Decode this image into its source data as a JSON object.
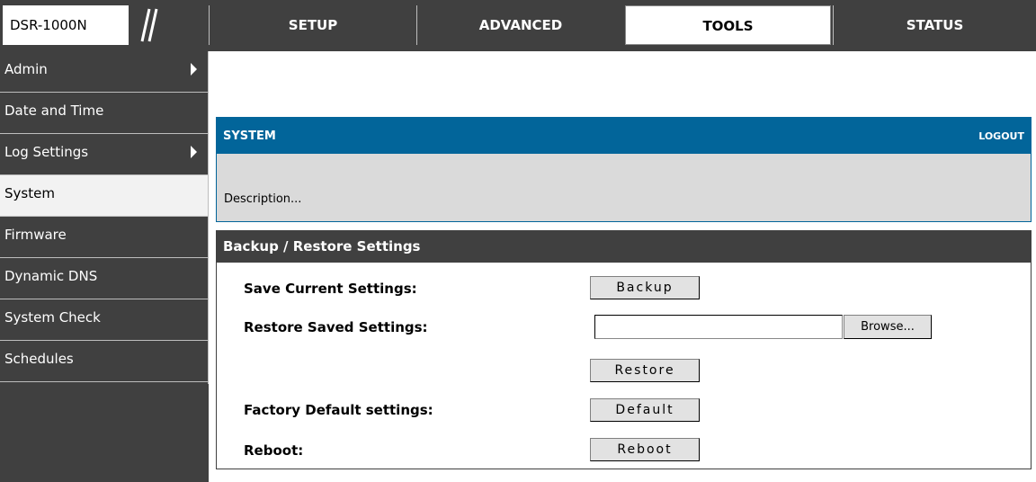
{
  "header": {
    "model": "DSR-1000N",
    "tabs": [
      {
        "label": "SETUP",
        "active": false
      },
      {
        "label": "ADVANCED",
        "active": false
      },
      {
        "label": "TOOLS",
        "active": true
      },
      {
        "label": "STATUS",
        "active": false
      }
    ]
  },
  "sidebar": {
    "items": [
      {
        "label": "Admin",
        "has_submenu": true,
        "active": false
      },
      {
        "label": "Date and Time",
        "has_submenu": false,
        "active": false
      },
      {
        "label": "Log Settings",
        "has_submenu": true,
        "active": false
      },
      {
        "label": "System",
        "has_submenu": false,
        "active": true
      },
      {
        "label": "Firmware",
        "has_submenu": false,
        "active": false
      },
      {
        "label": "Dynamic DNS",
        "has_submenu": false,
        "active": false
      },
      {
        "label": "System Check",
        "has_submenu": false,
        "active": false
      },
      {
        "label": "Schedules",
        "has_submenu": false,
        "active": false
      }
    ]
  },
  "system_panel": {
    "title": "SYSTEM",
    "logout_label": "LOGOUT",
    "description": "Description..."
  },
  "backup_panel": {
    "title": "Backup / Restore Settings",
    "save_label": "Save Current Settings:",
    "backup_button": "Backup",
    "restore_label": "Restore Saved Settings:",
    "file_value": "",
    "browse_button": "Browse...",
    "restore_button": "Restore",
    "factory_label": "Factory Default settings:",
    "default_button": "Default",
    "reboot_label": "Reboot:",
    "reboot_button": "Reboot"
  },
  "colors": {
    "nav_dark": "#404040",
    "accent_blue": "#02659a",
    "description_bg": "#dadada",
    "active_item_bg": "#f2f2f2"
  }
}
